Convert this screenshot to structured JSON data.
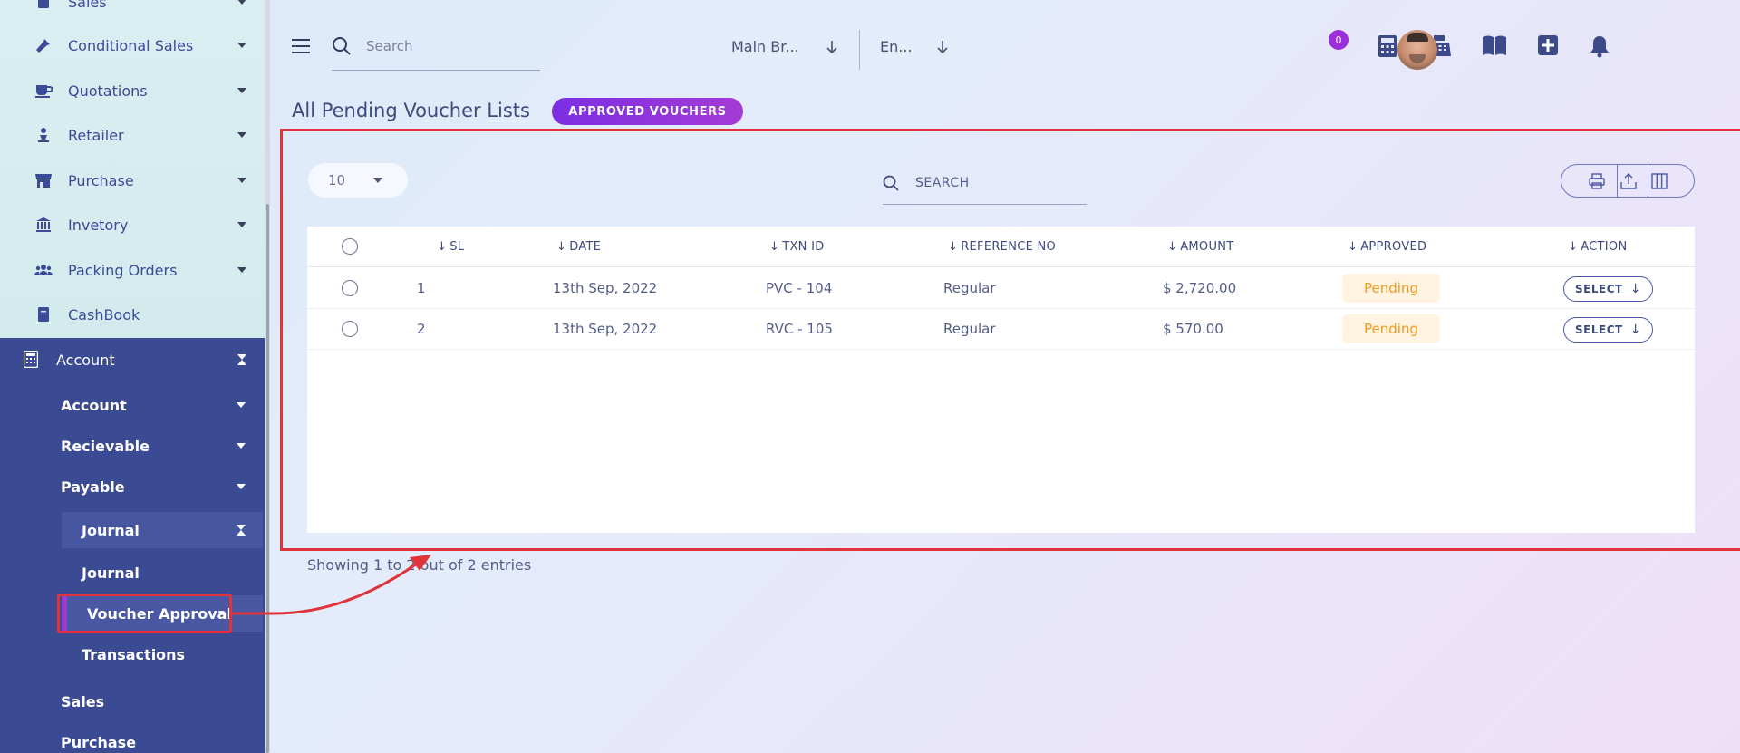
{
  "sidebar": {
    "items": [
      {
        "label": "Sales",
        "icon": "receipt-icon"
      },
      {
        "label": "Conditional Sales",
        "icon": "hammer-icon"
      },
      {
        "label": "Quotations",
        "icon": "coffee-cup-icon"
      },
      {
        "label": "Retailer",
        "icon": "person-icon"
      },
      {
        "label": "Purchase",
        "icon": "store-icon"
      },
      {
        "label": "Invetory",
        "icon": "bank-icon"
      },
      {
        "label": "Packing Orders",
        "icon": "users-icon"
      },
      {
        "label": "CashBook",
        "icon": "book-icon"
      }
    ],
    "account": {
      "label": "Account",
      "children": [
        "Account",
        "Recievable",
        "Payable"
      ],
      "journal_group": "Journal",
      "journal_children": [
        "Journal",
        "Voucher Approval",
        "Transactions"
      ],
      "trailing": [
        "Sales",
        "Purchase"
      ]
    }
  },
  "header": {
    "search_placeholder": "Search",
    "branch": "Main Br...",
    "language": "En...",
    "notification_count": "0"
  },
  "page": {
    "title": "All Pending Voucher Lists",
    "approved_button": "APPROVED VOUCHERS"
  },
  "table": {
    "per_page": "10",
    "search_label": "SEARCH",
    "columns": [
      "SL",
      "DATE",
      "TXN ID",
      "REFERENCE NO",
      "AMOUNT",
      "APPROVED",
      "ACTION"
    ],
    "rows": [
      {
        "sl": "1",
        "date": "13th Sep, 2022",
        "txn": "PVC - 104",
        "ref": "Regular",
        "amount": "$ 2,720.00",
        "approved": "Pending",
        "action": "SELECT"
      },
      {
        "sl": "2",
        "date": "13th Sep, 2022",
        "txn": "RVC - 105",
        "ref": "Regular",
        "amount": "$ 570.00",
        "approved": "Pending",
        "action": "SELECT"
      }
    ],
    "footer": "Showing 1 to 2 out of 2 entries"
  },
  "colors": {
    "accent": "#7c2ee3",
    "sidebar_dark": "#3a4a93",
    "highlight": "#e0333a",
    "pending": "#f19a20"
  }
}
